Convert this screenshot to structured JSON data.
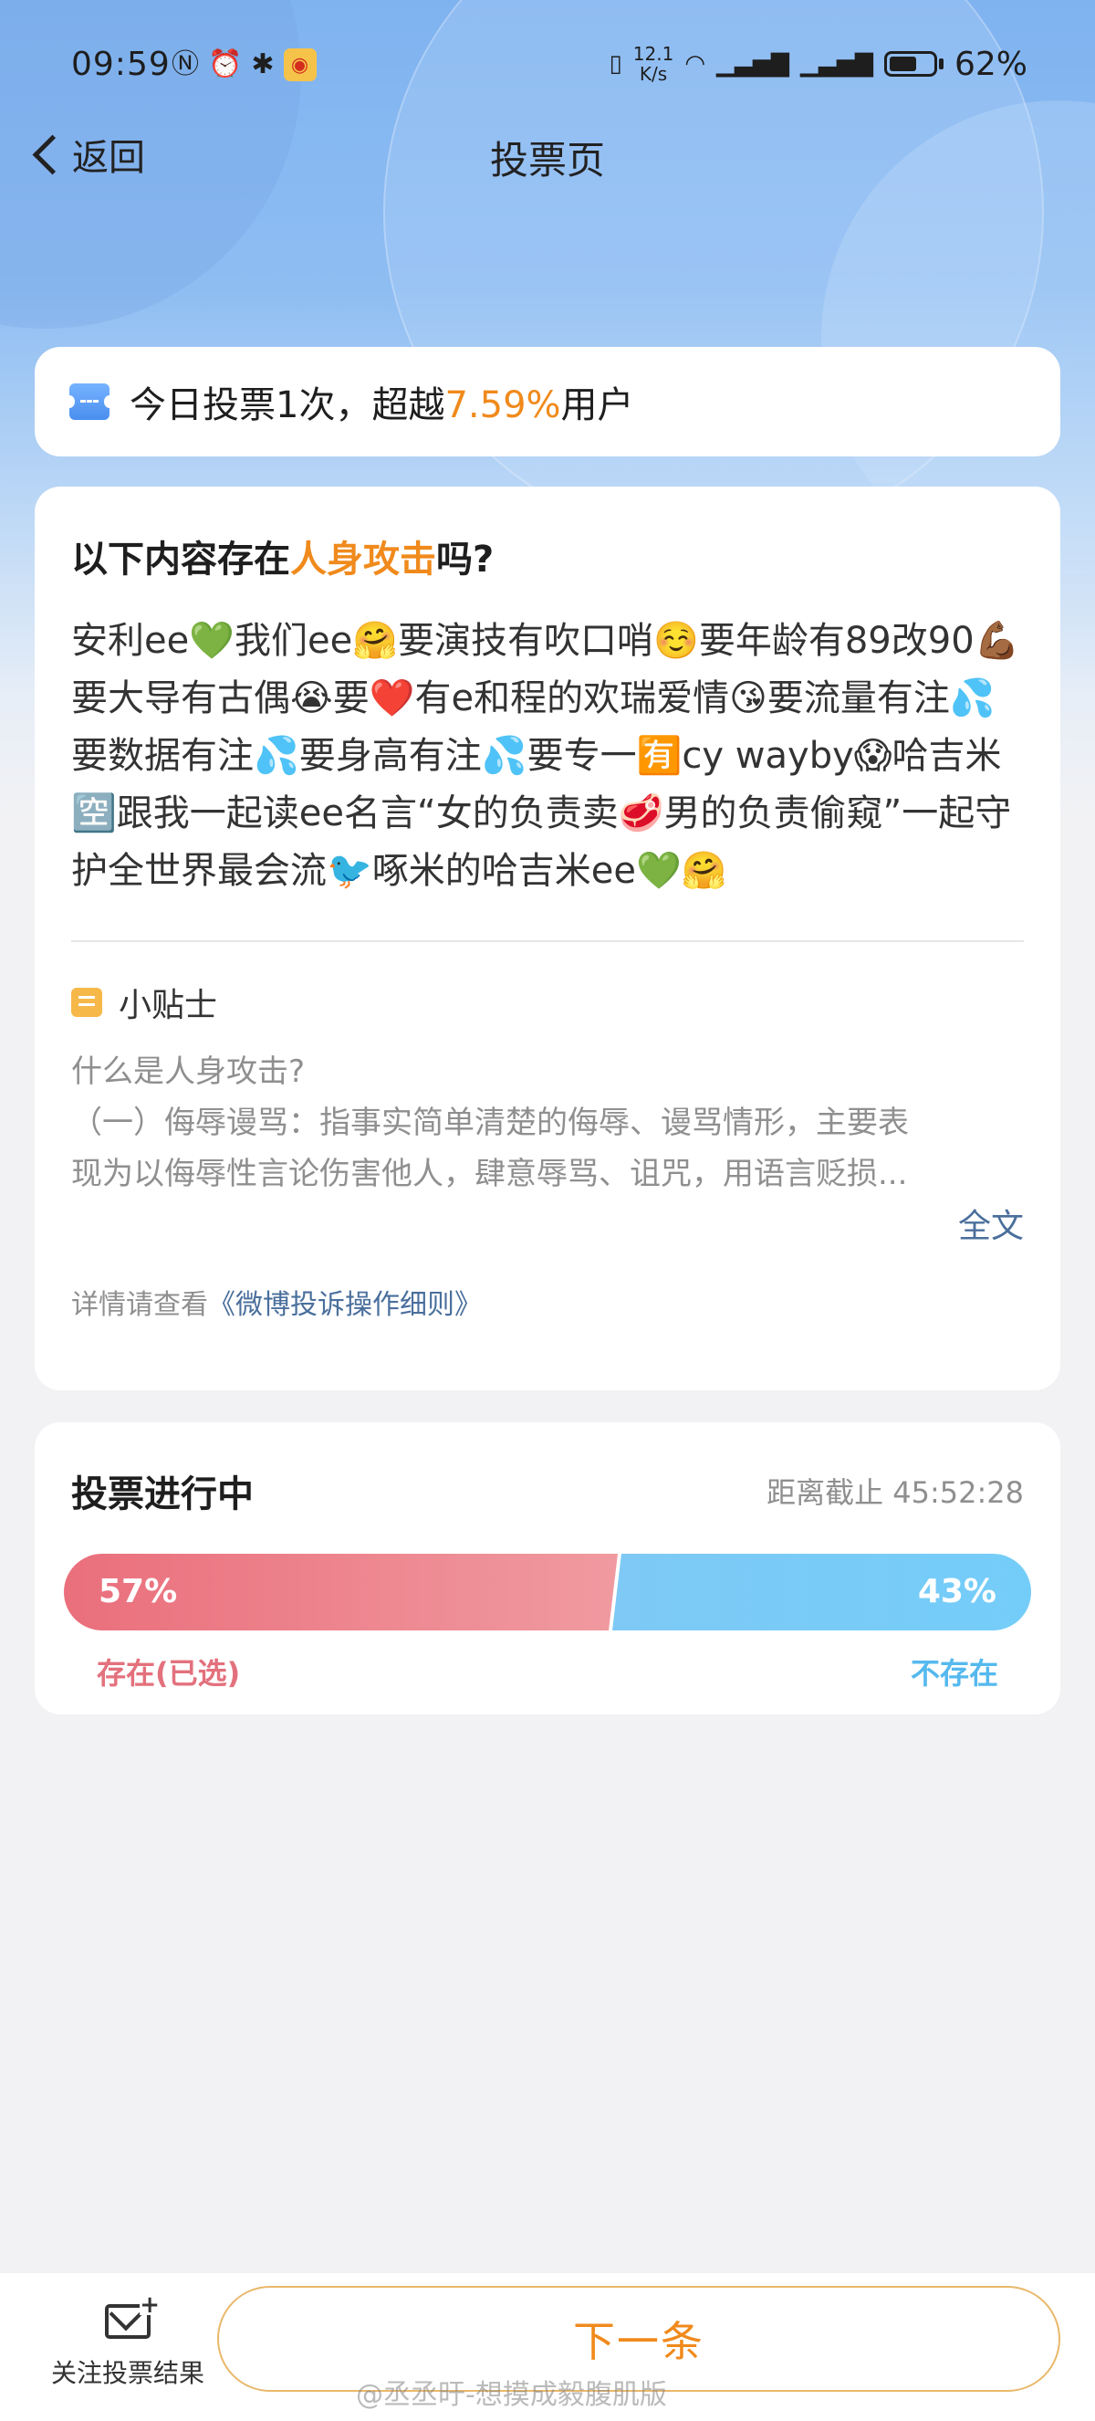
{
  "status_bar": {
    "time": "09:59",
    "net_speed_value": "12.1",
    "net_speed_unit": "K/s",
    "battery_percent_text": "62%",
    "battery_level": 0.62,
    "icons": [
      "nfc-icon",
      "alarm-icon",
      "bluetooth-icon",
      "weibo-icon",
      "vibrate-icon",
      "wifi-icon",
      "5g-signal-icon",
      "4g-signal-icon",
      "battery-icon"
    ]
  },
  "nav": {
    "back_label": "返回",
    "title": "投票页"
  },
  "stats": {
    "prefix": "今日投票1次，超越",
    "percent": "7.59%",
    "suffix": "用户"
  },
  "question": {
    "prefix": "以下内容存在",
    "highlight": "人身攻击",
    "suffix": "吗?"
  },
  "post": {
    "text": "安利ee💚我们ee🤗要演技有吹口哨☺️要年龄有89改90💪🏾要大导有古偶😭要❤️有e和程的欢瑞爱情😘要流量有注💦要数据有注💦要身高有注💦要专一🈶cy wayby😱哈吉米🈳跟我一起读ee名言“女的负责卖🥩男的负责偷窥”一起守护全世界最会流🐦啄米的哈吉米ee💚🤗"
  },
  "tips": {
    "title": "小贴士",
    "question": "什么是人身攻击?",
    "body_line1": "（一）侮辱谩骂：指事实简单清楚的侮辱、谩骂情形，主要表",
    "body_line2": "现为以侮辱性言论伤害他人，肆意辱骂、诅咒，用语言贬损...",
    "full_text_label": "全文",
    "detail_prefix": "详情请查看",
    "detail_link": "《微博投诉操作细则》"
  },
  "vote": {
    "title": "投票进行中",
    "deadline_label": "距离截止",
    "deadline_value": "45:52:28",
    "option_left": {
      "label": "存在(已选)",
      "percent_text": "57%",
      "fraction": 0.57,
      "color": "#e3717d"
    },
    "option_right": {
      "label": "不存在",
      "percent_text": "43%",
      "fraction": 0.43,
      "color": "#55b9ee"
    }
  },
  "bottom": {
    "follow_label": "关注投票结果",
    "next_label": "下一条",
    "watermark": "@丞丞旴-想摸成毅腹肌版"
  },
  "colors": {
    "accent": "#f08a1c",
    "link": "#4a6f9c"
  }
}
